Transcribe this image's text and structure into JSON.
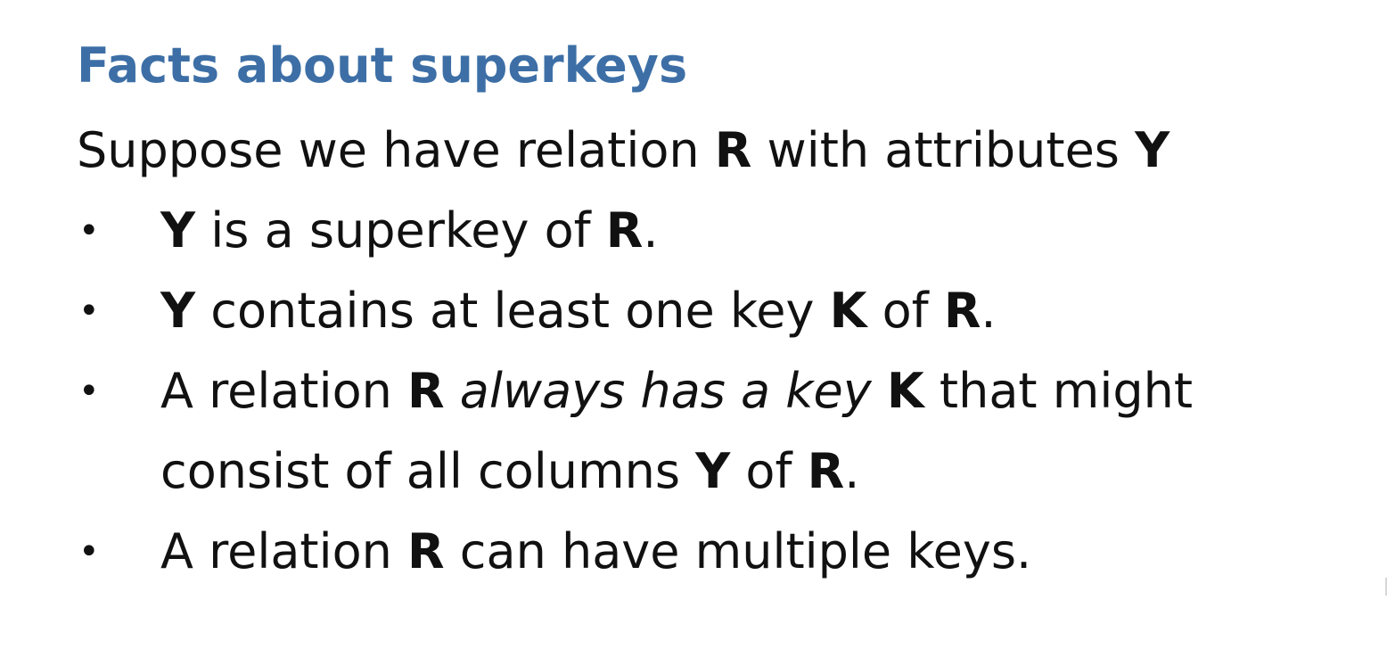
{
  "slide": {
    "title": "Facts about superkeys",
    "intro": {
      "t1": "Suppose we have relation ",
      "r": "R",
      "t2": " with attributes ",
      "y": "Y"
    },
    "bullet_symbol": "•",
    "bullets": [
      {
        "y": "Y",
        "t1": " is a superkey of ",
        "r": "R",
        "t2": "."
      },
      {
        "y": "Y",
        "t1": " contains at least one key ",
        "k": "K",
        "t2": " of ",
        "r": "R",
        "t3": "."
      },
      {
        "t1": "A relation ",
        "r": "R",
        "italic": " always has a key ",
        "k": "K",
        "t2": " that might consist of all columns ",
        "y": "Y",
        "t3": " of ",
        "r2": "R",
        "t4": "."
      },
      {
        "t1": "A relation ",
        "r": "R",
        "t2": " can have multiple keys."
      }
    ]
  }
}
